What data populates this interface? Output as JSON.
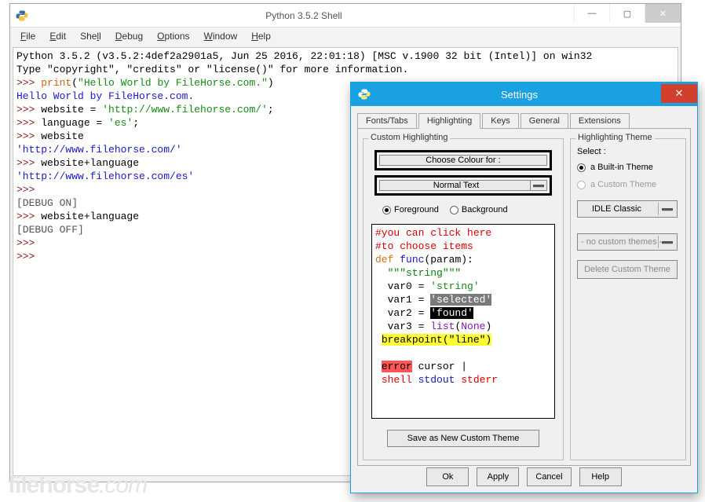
{
  "shell": {
    "title": "Python 3.5.2 Shell",
    "menu": {
      "file": "File",
      "edit": "Edit",
      "shell": "Shell",
      "debug": "Debug",
      "options": "Options",
      "window": "Window",
      "help": "Help"
    },
    "banner_line1": "Python 3.5.2 (v3.5.2:4def2a2901a5, Jun 25 2016, 22:01:18) [MSC v.1900 32 bit (Intel)] on win32",
    "banner_line2": "Type \"copyright\", \"credits\" or \"license()\" for more information.",
    "prompt": ">>> ",
    "print_kw": "print",
    "print_arg": "\"Hello World by FileHorse.com.\"",
    "out1": "Hello World by FileHorse.com.",
    "assign_website": "website = ",
    "website_val": "'http://www.filehorse.com/'",
    "semi": ";",
    "assign_lang": "language = ",
    "lang_val": "'es'",
    "echo_website_label": "website",
    "echo_website_out": "'http://www.filehorse.com/'",
    "echo_sum_label": "website+language",
    "echo_sum_out": "'http://www.filehorse.com/es'",
    "debug_on": "[DEBUG ON]",
    "debug_off": "[DEBUG OFF]"
  },
  "settings": {
    "title": "Settings",
    "tabs": {
      "fonts": "Fonts/Tabs",
      "highlighting": "Highlighting",
      "keys": "Keys",
      "general": "General",
      "extensions": "Extensions"
    },
    "left_legend": "Custom Highlighting",
    "choose_colour": "Choose Colour for :",
    "normal_text": "Normal Text",
    "radio_fg": "Foreground",
    "radio_bg": "Background",
    "save_btn": "Save as New Custom Theme",
    "preview": {
      "c1": "#you can click here",
      "c2": "#to choose items",
      "def": "def ",
      "fn": "func",
      "paren": "(param):",
      "doc": "\"\"\"string\"\"\"",
      "v0a": "var0 = ",
      "v0b": "'string'",
      "v1a": "var1 = ",
      "v1b": "'selected'",
      "v2a": "var2 = ",
      "v2b": "'found'",
      "v3a": "var3 = ",
      "v3b": "list",
      "v3c": "None",
      "bp": "breakpoint(\"line\")",
      "err": "error",
      "cursor": " cursor |",
      "shell": "shell",
      "stdout": " stdout",
      "stderr": " stderr"
    },
    "right_legend": "Highlighting Theme",
    "select_label": "Select :",
    "builtin_label": "a Built-in Theme",
    "custom_label": "a Custom Theme",
    "theme_name": "IDLE Classic",
    "no_custom": "- no custom themes -",
    "delete_btn": "Delete Custom Theme",
    "buttons": {
      "ok": "Ok",
      "apply": "Apply",
      "cancel": "Cancel",
      "help": "Help"
    }
  },
  "watermark_a": "filehorse",
  "watermark_b": ".com"
}
